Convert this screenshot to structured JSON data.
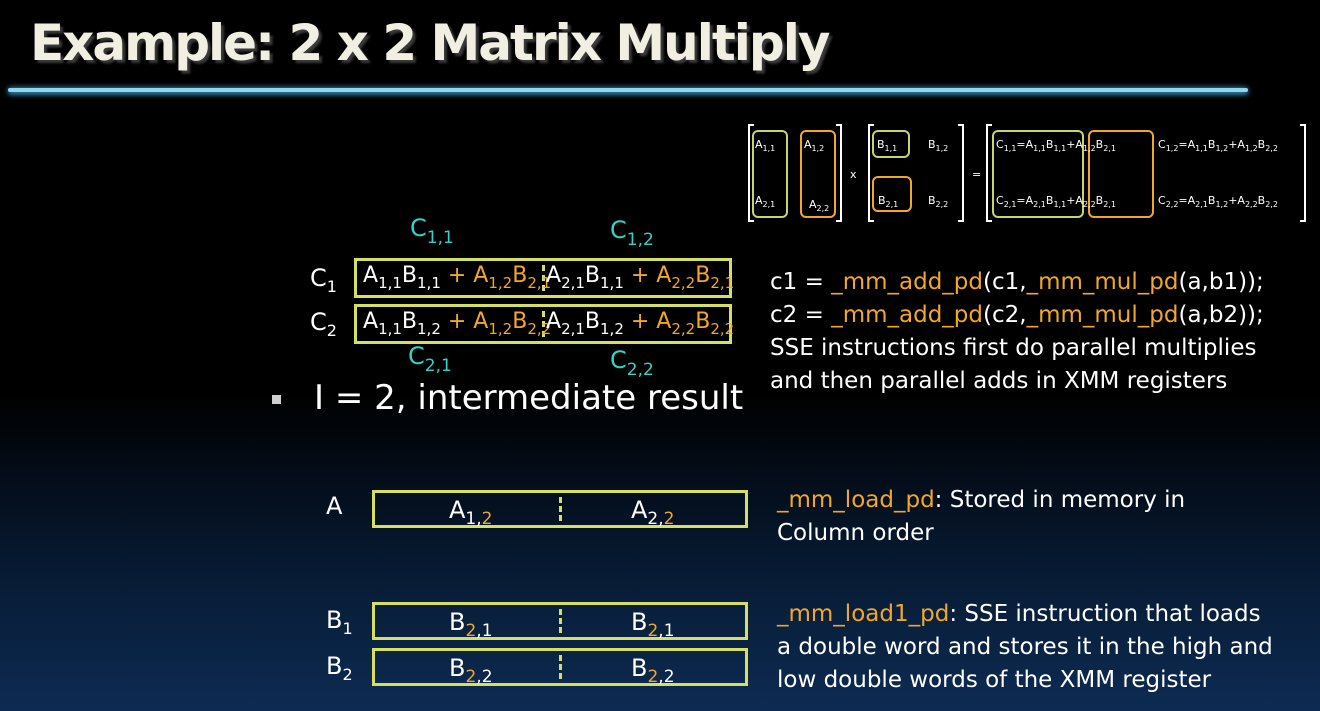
{
  "title": "Example: 2 x 2 Matrix Multiply",
  "matrix_diagram": {
    "a11": "A",
    "a12": "A",
    "a21": "A",
    "a22": "A",
    "b11": "B",
    "b12": "B",
    "b21": "B",
    "b22": "B",
    "times": "x",
    "equals": "=",
    "c11_lhs": "C",
    "c12": "C",
    "c21_lhs": "C",
    "c22": "C"
  },
  "column_labels": {
    "top_left": "C",
    "top_right": "C",
    "bottom_left": "C",
    "bottom_right": "C"
  },
  "rows": [
    {
      "label": "C"
    },
    {
      "label": "C"
    }
  ],
  "code": {
    "line1_pre": "c1 = ",
    "line1_fn1": "_mm_add_pd",
    "line1_mid": "(c1,",
    "line1_fn2": "_mm_mul_pd",
    "line1_post": "(a,b1));",
    "line2_pre": "c2 = ",
    "line2_fn1": "_mm_add_pd",
    "line2_mid": "(c2,",
    "line2_fn2": "_mm_mul_pd",
    "line2_post": "(a,b2));",
    "line3": "SSE instructions first do parallel multiplies",
    "line4": "and then parallel adds in XMM registers"
  },
  "bullet": "I = 2, intermediate result",
  "register_a": {
    "label": "A",
    "left": "A",
    "right": "A"
  },
  "register_b1": {
    "label": "B",
    "left": "B",
    "right": "B"
  },
  "register_b2": {
    "label": "B",
    "left": "B",
    "right": "B"
  },
  "desc_load": {
    "fn": "_mm_load_pd",
    "text1": ": Stored in memory in",
    "text2": "Column order"
  },
  "desc_load1": {
    "fn": "_mm_load1_pd",
    "text1": ": SSE instruction that loads",
    "text2": "a double word and stores it in the high and",
    "text3": "low double words of the XMM register"
  },
  "colors": {
    "highlight_yellow": "#d7df62",
    "accent_orange": "#f2a72a",
    "cyan": "#32d3c8",
    "title_rule": "#8fd6f0"
  }
}
